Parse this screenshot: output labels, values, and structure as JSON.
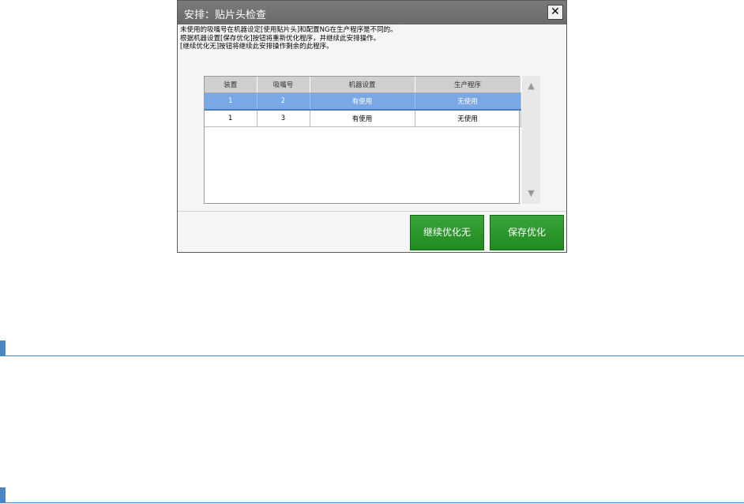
{
  "dialog": {
    "title": "安排：贴片头检查",
    "close_label": "✕",
    "message_lines": [
      "未使用的吸嘴号在机器设定[使用贴片头]和配置NG在生产程序是不同的。",
      "根据机器设置[保存优化]按钮将重新优化程序，并继续此安排操作。",
      "[继续优化无]按钮将继续此安排操作剩余的此程序。"
    ],
    "table": {
      "headers": [
        "装置",
        "吸嘴号",
        "机器设置",
        "生产程序"
      ],
      "rows": [
        {
          "device": "1",
          "nozzle": "2",
          "machine": "有使用",
          "program": "无使用",
          "selected": true
        },
        {
          "device": "1",
          "nozzle": "3",
          "machine": "有使用",
          "program": "无使用",
          "selected": false
        }
      ]
    },
    "scroll": {
      "up_icon": "▲",
      "down_icon": "▼"
    },
    "buttons": {
      "continue_label": "继续优化无",
      "save_label": "保存优化"
    },
    "colors": {
      "title_bar": "#6e6e6e",
      "selected_row": "#7aa7e6",
      "button_green": "#2a9a2a",
      "section_rule": "#4a85c4"
    }
  }
}
